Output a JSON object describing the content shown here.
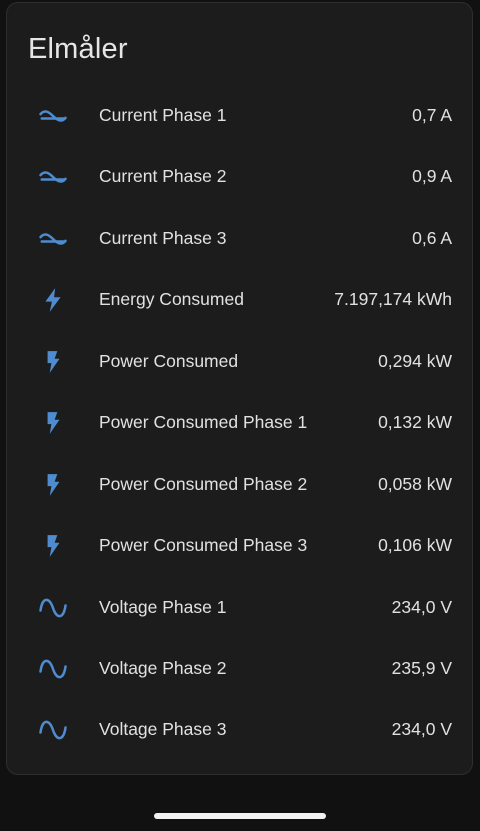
{
  "card": {
    "title": "Elmåler"
  },
  "colors": {
    "icon": "#4e8ccf",
    "text": "#e1e1e1",
    "card_bg": "#1c1c1c",
    "page_bg": "#111111"
  },
  "entities": [
    {
      "name": "Current Phase 1",
      "value": "0,7 A",
      "icon": "current-ac-icon"
    },
    {
      "name": "Current Phase 2",
      "value": "0,9 A",
      "icon": "current-ac-icon"
    },
    {
      "name": "Current Phase 3",
      "value": "0,6 A",
      "icon": "current-ac-icon"
    },
    {
      "name": "Energy Consumed",
      "value": "7.197,174 kWh",
      "icon": "lightning-bolt-icon"
    },
    {
      "name": "Power Consumed",
      "value": "0,294 kW",
      "icon": "flash-icon"
    },
    {
      "name": "Power Consumed Phase 1",
      "value": "0,132 kW",
      "icon": "flash-icon"
    },
    {
      "name": "Power Consumed Phase 2",
      "value": "0,058 kW",
      "icon": "flash-icon"
    },
    {
      "name": "Power Consumed Phase 3",
      "value": "0,106 kW",
      "icon": "flash-icon"
    },
    {
      "name": "Voltage Phase 1",
      "value": "234,0 V",
      "icon": "sine-wave-icon"
    },
    {
      "name": "Voltage Phase 2",
      "value": "235,9 V",
      "icon": "sine-wave-icon"
    },
    {
      "name": "Voltage Phase 3",
      "value": "234,0 V",
      "icon": "sine-wave-icon"
    }
  ]
}
